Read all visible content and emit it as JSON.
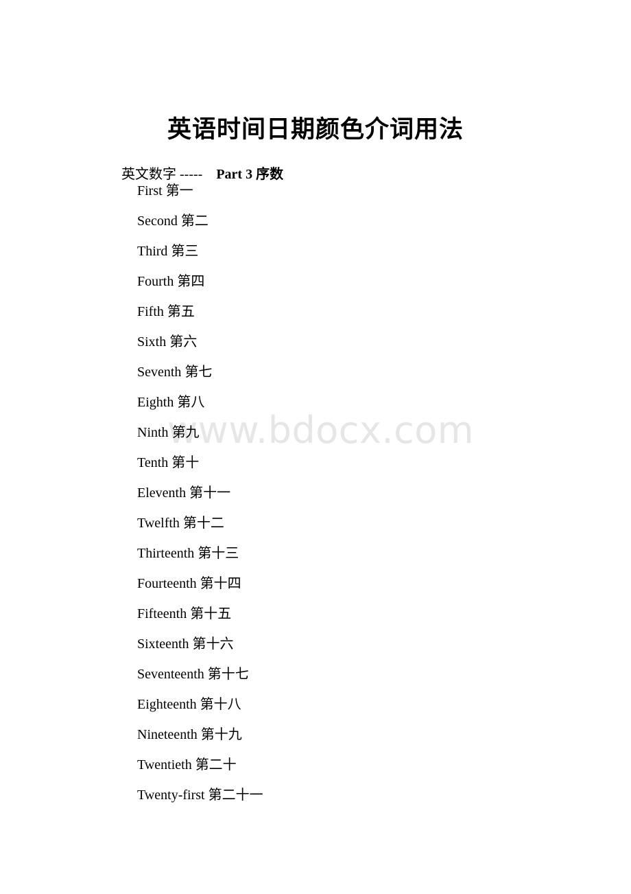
{
  "document": {
    "title": "英语时间日期颜色介词用法",
    "subtitle": {
      "lead": "英文数字 -----",
      "part": "Part 3 序数"
    },
    "watermark": "www.bdocx.com"
  },
  "ordinals": [
    {
      "en": "First",
      "zh": "第一"
    },
    {
      "en": "Second",
      "zh": "第二"
    },
    {
      "en": "Third",
      "zh": "第三"
    },
    {
      "en": "Fourth",
      "zh": "第四"
    },
    {
      "en": "Fifth",
      "zh": "第五"
    },
    {
      "en": "Sixth",
      "zh": "第六"
    },
    {
      "en": "Seventh",
      "zh": "第七"
    },
    {
      "en": "Eighth",
      "zh": "第八"
    },
    {
      "en": "Ninth",
      "zh": "第九"
    },
    {
      "en": "Tenth",
      "zh": "第十"
    },
    {
      "en": "Eleventh",
      "zh": "第十一"
    },
    {
      "en": "Twelfth",
      "zh": "第十二"
    },
    {
      "en": "Thirteenth",
      "zh": "第十三"
    },
    {
      "en": "Fourteenth",
      "zh": "第十四"
    },
    {
      "en": "Fifteenth",
      "zh": "第十五"
    },
    {
      "en": "Sixteenth",
      "zh": "第十六"
    },
    {
      "en": "Seventeenth",
      "zh": "第十七"
    },
    {
      "en": "Eighteenth",
      "zh": "第十八"
    },
    {
      "en": "Nineteenth",
      "zh": "第十九"
    },
    {
      "en": "Twentieth",
      "zh": "第二十"
    },
    {
      "en": "Twenty-first",
      "zh": "第二十一"
    }
  ],
  "colors": {
    "text": "#000000",
    "watermark": "#e6e6e6",
    "page_background": "#ffffff"
  }
}
